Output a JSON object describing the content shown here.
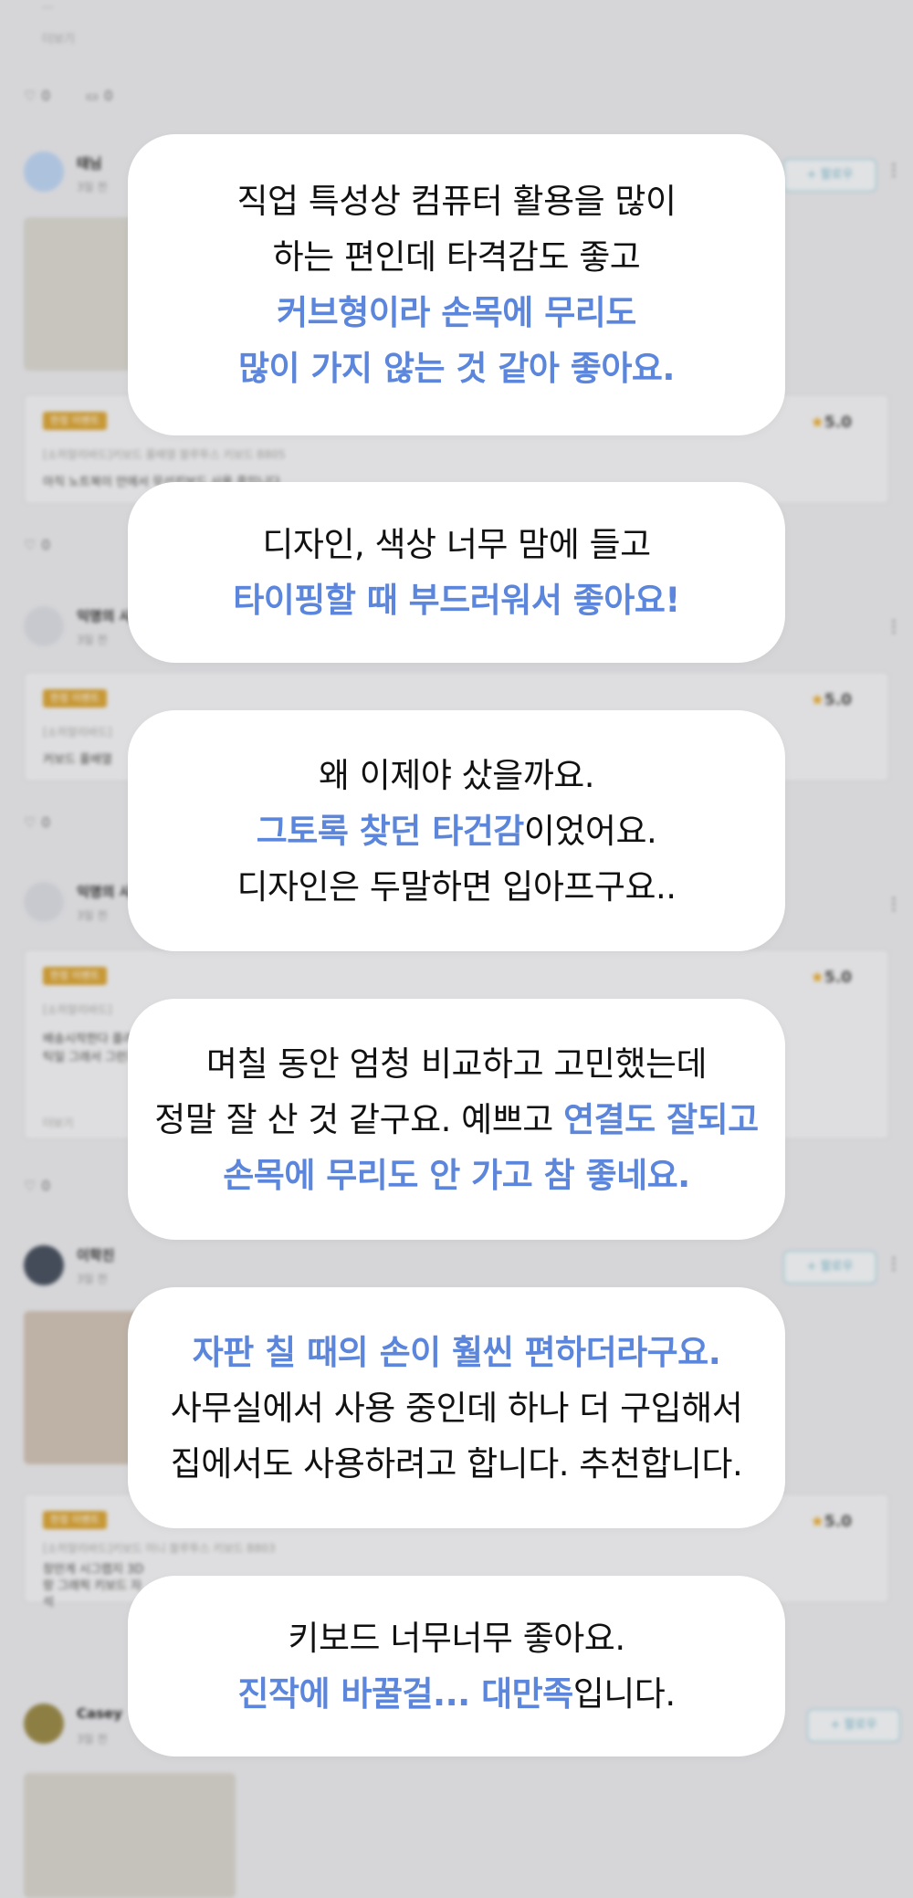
{
  "colors": {
    "highlight": "#5b86dc",
    "text": "#111111",
    "bubble_bg": "#ffffff"
  },
  "feed": {
    "more_link": "더보기",
    "like_count": "0",
    "comment_count": "0",
    "follow_label": "+ 팔로우",
    "rating": "5.0",
    "badge_label": "한정 이벤트",
    "posts": [
      {
        "username": "태님",
        "date": "3일 전",
        "product": "[소히알리바드]키보드 풀배열 블루투스 키보드 B805",
        "review": "아직 노트북이 안에서 무선키보드 사용 중입니다"
      },
      {
        "username": "익명의 사",
        "date": "3일 전",
        "product": "[소히알리바드]",
        "review": "커보드 풀배열"
      },
      {
        "username": "익명의 사",
        "date": "3일 전",
        "product": "[소히알리바드]",
        "review": "배송시작한다 플라스틱일 그래서 그런지"
      },
      {
        "username": "이학진",
        "date": "3일 전",
        "product": "[소히알리바드]키보드 미니 블루투스 키보드 B803",
        "review": "창만게 시그랩지 3D랑 그래픽 키보드 자석"
      },
      {
        "username": "Casey",
        "date": "3일 전",
        "product": "",
        "review": ""
      }
    ]
  },
  "quotes": [
    {
      "lines": [
        [
          {
            "t": "직업 특성상 컴퓨터 활용을 많이",
            "h": false
          }
        ],
        [
          {
            "t": "하는 편인데 타격감도 좋고",
            "h": false
          }
        ],
        [
          {
            "t": "커브형이라 손목에 무리도",
            "h": true
          }
        ],
        [
          {
            "t": "많이 가지 않는 것 같아 좋아요.",
            "h": true
          }
        ]
      ]
    },
    {
      "lines": [
        [
          {
            "t": "디자인, 색상 너무 맘에 들고",
            "h": false
          }
        ],
        [
          {
            "t": "타이핑할 때 부드러워서 좋아요!",
            "h": true
          }
        ]
      ]
    },
    {
      "lines": [
        [
          {
            "t": "왜 이제야 샀을까요.",
            "h": false
          }
        ],
        [
          {
            "t": "그토록 찾던 타건감",
            "h": true
          },
          {
            "t": "이었어요.",
            "h": false
          }
        ],
        [
          {
            "t": "디자인은 두말하면 입아프구요..",
            "h": false
          }
        ]
      ]
    },
    {
      "lines": [
        [
          {
            "t": "며칠 동안 엄청 비교하고 고민했는데",
            "h": false
          }
        ],
        [
          {
            "t": "정말 잘 산 것 같구요. 예쁘고 ",
            "h": false
          },
          {
            "t": "연결도 잘되고",
            "h": true
          }
        ],
        [
          {
            "t": "손목에 무리도 안 가고 참 좋네요.",
            "h": true
          }
        ]
      ]
    },
    {
      "lines": [
        [
          {
            "t": "자판 칠 때의 손이 훨씬 편하더라구요.",
            "h": true
          }
        ],
        [
          {
            "t": "사무실에서 사용 중인데 하나 더 구입해서",
            "h": false
          }
        ],
        [
          {
            "t": "집에서도 사용하려고 합니다. 추천합니다.",
            "h": false
          }
        ]
      ]
    },
    {
      "lines": [
        [
          {
            "t": "키보드 너무너무 좋아요.",
            "h": false
          }
        ],
        [
          {
            "t": "진작에 바꿀걸... 대만족",
            "h": true
          },
          {
            "t": "입니다.",
            "h": false
          }
        ]
      ]
    }
  ]
}
